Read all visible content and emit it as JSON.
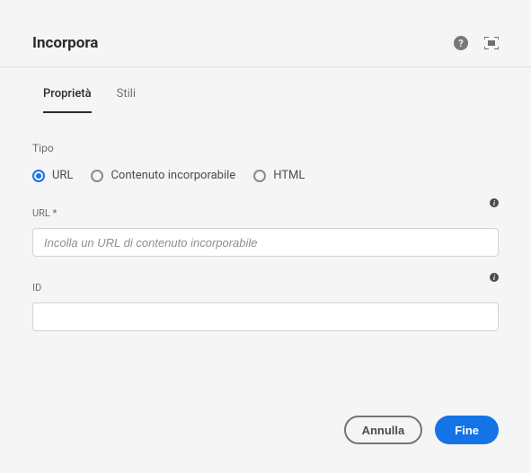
{
  "header": {
    "title": "Incorpora"
  },
  "tabs": {
    "items": [
      {
        "label": "Proprietà",
        "active": true
      },
      {
        "label": "Stili",
        "active": false
      }
    ]
  },
  "form": {
    "type_label": "Tipo",
    "radio_options": [
      {
        "label": "URL",
        "selected": true
      },
      {
        "label": "Contenuto incorporabile",
        "selected": false
      },
      {
        "label": "HTML",
        "selected": false
      }
    ],
    "url_field": {
      "label": "URL *",
      "placeholder": "Incolla un URL di contenuto incorporabile",
      "value": ""
    },
    "id_field": {
      "label": "ID",
      "placeholder": "",
      "value": ""
    }
  },
  "footer": {
    "cancel_label": "Annulla",
    "done_label": "Fine"
  }
}
